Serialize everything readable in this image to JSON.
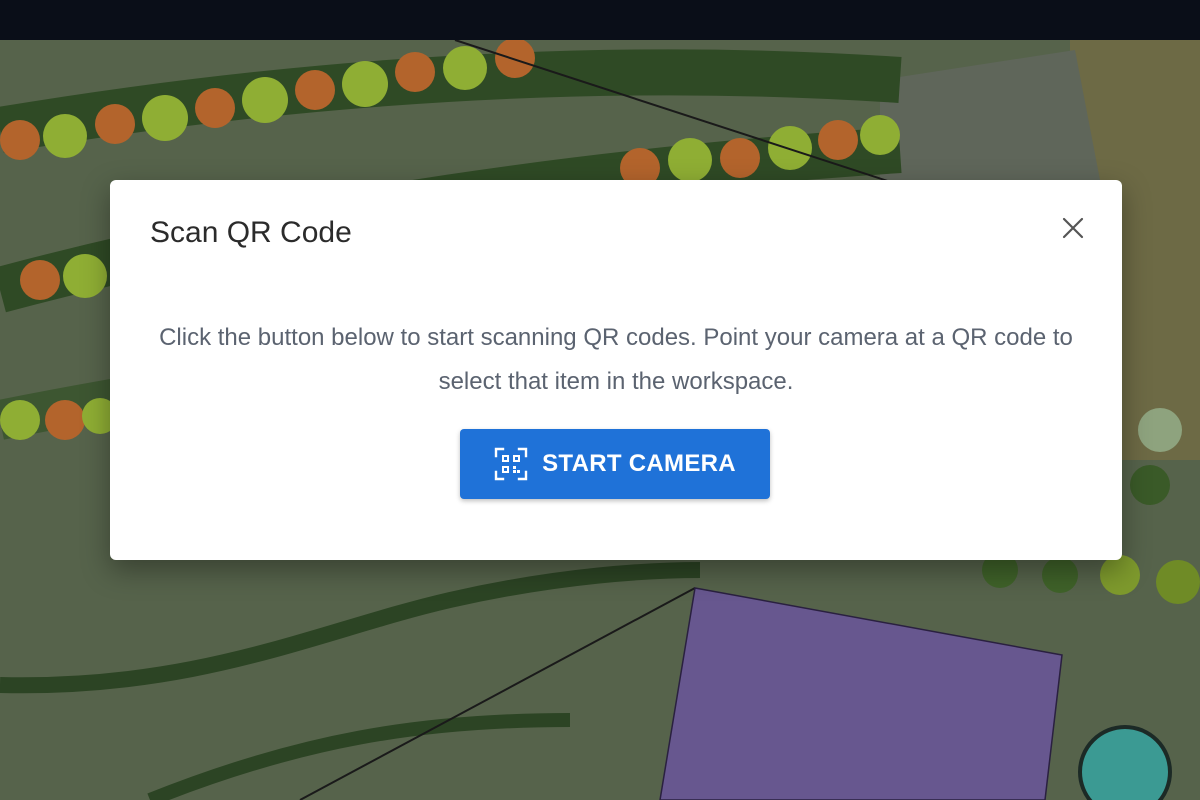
{
  "modal": {
    "title": "Scan QR Code",
    "description": "Click the button below to start scanning QR codes. Point your camera at a QR code to select that item in the workspace.",
    "start_button_label": "START CAMERA",
    "start_button_icon": "qr-code-scan-icon",
    "close_icon": "close-icon"
  },
  "colors": {
    "accent": "#1f72d8",
    "zone": "#6a5599",
    "marker": "#3b9a93"
  }
}
